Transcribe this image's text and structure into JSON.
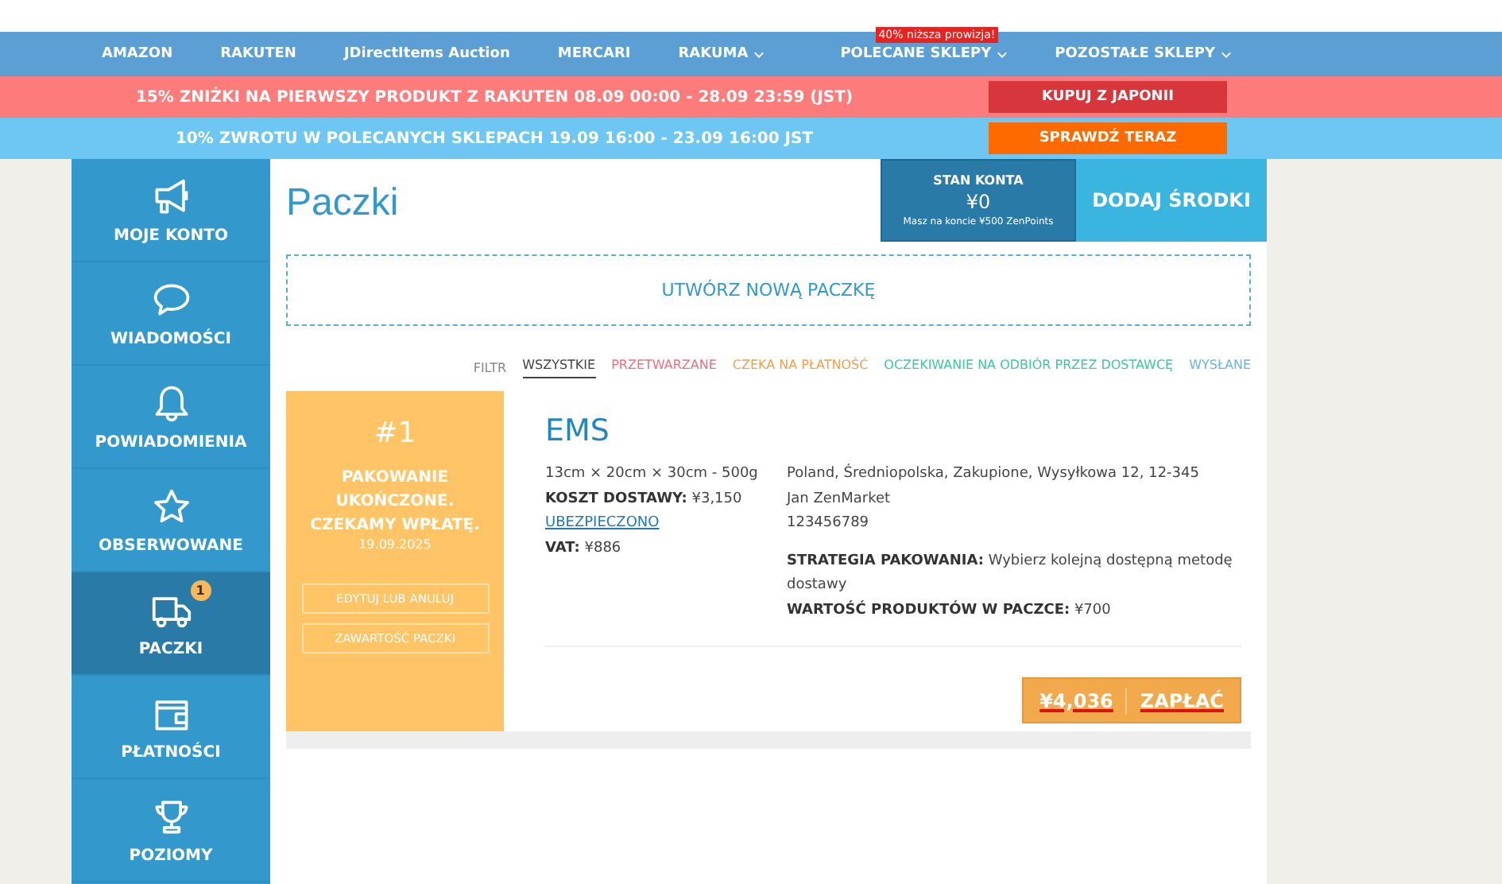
{
  "nav": {
    "items": [
      {
        "label": "AMAZON",
        "dropdown": false
      },
      {
        "label": "RAKUTEN",
        "dropdown": false
      },
      {
        "label": "JDirectItems Auction",
        "dropdown": false
      },
      {
        "label": "MERCARI",
        "dropdown": false
      },
      {
        "label": "RAKUMA",
        "dropdown": true
      },
      {
        "label": "POLECANE SKLEPY",
        "dropdown": true,
        "badge": "40% niższa prowizja!"
      },
      {
        "label": "POZOSTAŁE SKLEPY",
        "dropdown": true
      }
    ]
  },
  "banners": [
    {
      "kind": "red",
      "text": "15% ZNIŻKI NA PIERWSZY PRODUKT Z RAKUTEN 08.09 00:00 - 28.09 23:59 (JST)",
      "button": "KUPUJ Z JAPONII"
    },
    {
      "kind": "blue",
      "text": "10% ZWROTU W POLECANYCH SKLEPACH 19.09 16:00 - 23.09 16:00 JST",
      "button": "SPRAWDŹ TERAZ"
    }
  ],
  "sidebar": {
    "items": [
      {
        "label": "MOJE KONTO",
        "selected": false
      },
      {
        "label": "WIADOMOŚCI",
        "selected": false
      },
      {
        "label": "POWIADOMIENIA",
        "selected": false
      },
      {
        "label": "OBSERWOWANE",
        "selected": false
      },
      {
        "label": "PACZKI",
        "selected": true,
        "badge": "1"
      },
      {
        "label": "PŁATNOŚCI",
        "selected": false
      },
      {
        "label": "POZIOMY",
        "selected": false
      }
    ]
  },
  "page": {
    "title": "Paczki"
  },
  "account": {
    "label": "STAN KONTA",
    "balance": "¥0",
    "points": "Masz na koncie ¥500 ZenPoints",
    "add_button": "DODAJ ŚRODKI"
  },
  "create_button": "UTWÓRZ NOWĄ PACZKĘ",
  "filter": {
    "label": "FILTR",
    "items": [
      {
        "label": "WSZYSTKIE",
        "selected": true,
        "color": "#444444"
      },
      {
        "label": "PRZETWARZANE",
        "selected": false,
        "color": "#f0707a"
      },
      {
        "label": "CZEKA NA PŁATNOŚĆ",
        "selected": false,
        "color": "#f0a050"
      },
      {
        "label": "OCZEKIWANIE NA ODBIÓR PRZEZ DOSTAWCĘ",
        "selected": false,
        "color": "#3cc8a0"
      },
      {
        "label": "WYSŁANE",
        "selected": false,
        "color": "#6cb0ee"
      }
    ]
  },
  "packages": [
    {
      "number": "#1",
      "status": "PAKOWANIE UKOŃCZONE. CZEKAMY WPŁATĘ.",
      "date": "19.09.2025",
      "actions": [
        "EDYTUJ LUB ANULUJ",
        "ZAWARTOŚĆ PACZKI"
      ],
      "carrier": "EMS",
      "dimensions": "13cm × 20cm × 30cm - 500g",
      "shipping_cost": {
        "label": "KOSZT DOSTAWY:",
        "value": "¥3,150"
      },
      "insured": "UBEZPIECZONO",
      "vat": {
        "label": "VAT:",
        "value": "¥886"
      },
      "address": [
        "Poland, Średniopolska, Zakupione, Wysyłkowa 12, 12-345",
        "Jan ZenMarket",
        "123456789"
      ],
      "strategy": {
        "label": "STRATEGIA PAKOWANIA:",
        "value": "Wybierz kolejną dostępną metodę dostawy"
      },
      "value": {
        "label": "WARTOŚĆ PRODUKTÓW W PACZCE:",
        "value": "¥700"
      },
      "total": "¥4,036",
      "pay_button": "ZAPŁAĆ"
    }
  ]
}
